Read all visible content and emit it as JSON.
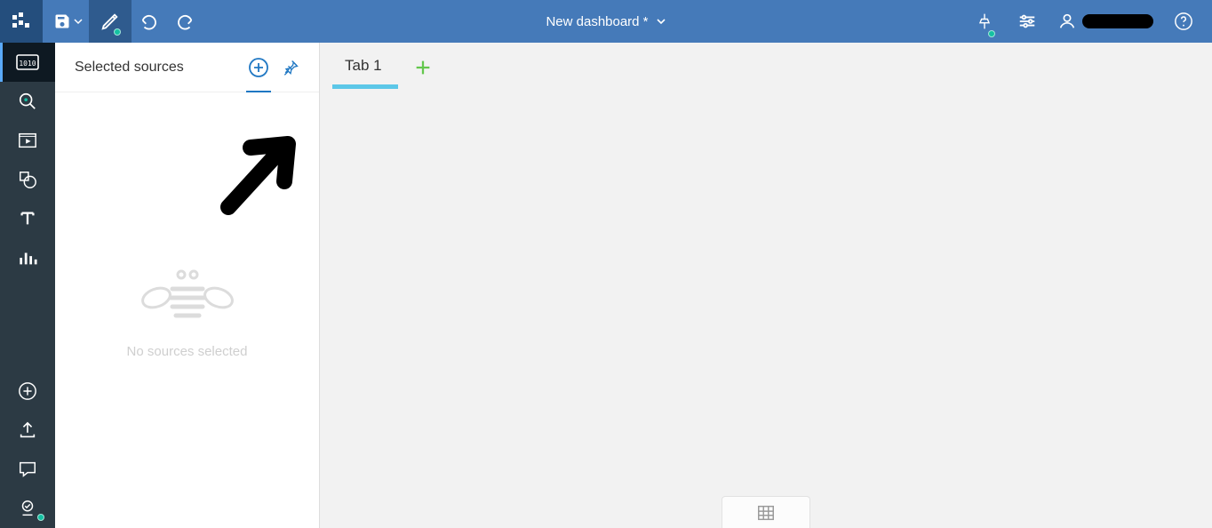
{
  "header": {
    "title": "New dashboard *"
  },
  "panel": {
    "title": "Selected sources",
    "empty_text": "No sources selected"
  },
  "tabs": [
    {
      "label": "Tab 1",
      "active": true
    }
  ]
}
